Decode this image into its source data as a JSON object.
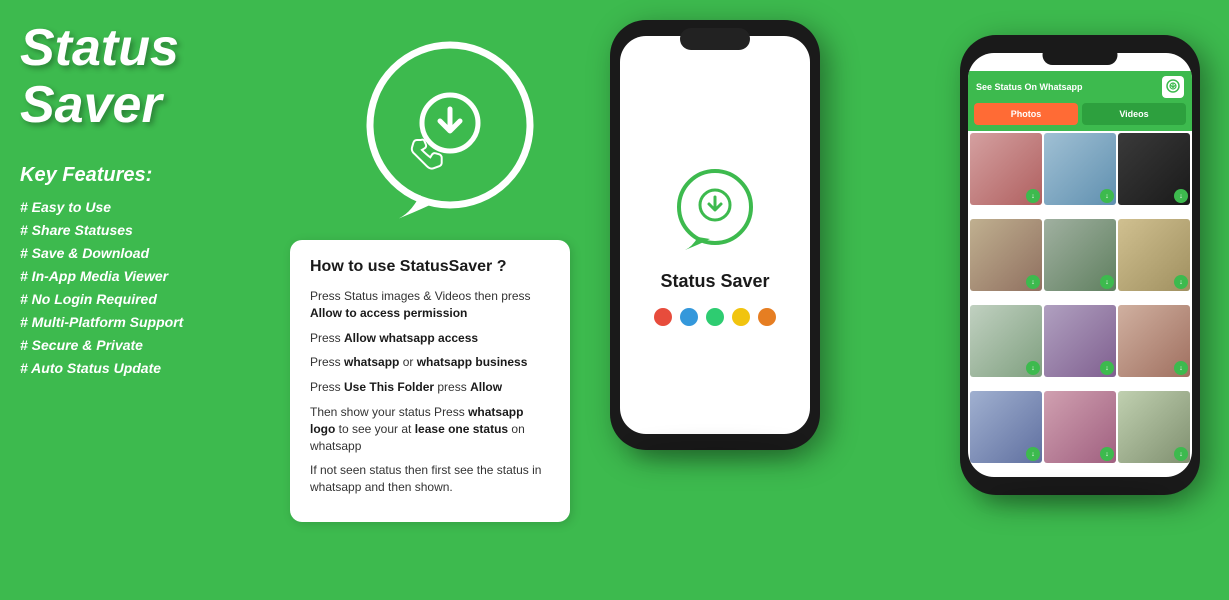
{
  "app": {
    "title": "Status Saver",
    "background_color": "#3dba4e"
  },
  "left": {
    "title": "Status Saver",
    "key_features_label": "Key Features:",
    "features": [
      "# Easy to Use",
      "# Share Statuses",
      "# Save & Download",
      "# In-App Media Viewer",
      "# No Login Required",
      "# Multi-Platform Support",
      "# Secure & Private",
      "# Auto Status Update"
    ]
  },
  "instruction_box": {
    "title": "How to use StatusSaver ?",
    "steps": [
      "Press Status images & Videos then press **Allow to access permission**",
      "Press **Allow whatsapp access**",
      "Press **whatsapp** or **whatsapp business**",
      "Press **Use This Folder** press **Allow**",
      "Then show your status Press **whatsapp logo** to see your at **lease one status** on whatsapp",
      "If not seen status then first see the status in whatsapp and then shown."
    ]
  },
  "phone1": {
    "app_name": "Status Saver",
    "dots": [
      "#e74c3c",
      "#3498db",
      "#2ecc71",
      "#f1c40f",
      "#e67e22"
    ]
  },
  "phone2": {
    "header_text": "See Status On Whatsapp",
    "tab_photos": "Photos",
    "tab_videos": "Videos"
  },
  "icons": {
    "download": "⬇",
    "whatsapp_header": "📱"
  }
}
